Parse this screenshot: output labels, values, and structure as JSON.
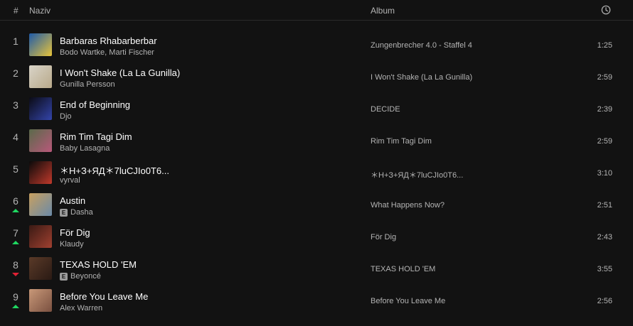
{
  "header": {
    "num_label": "#",
    "title_label": "Naziv",
    "album_label": "Album",
    "duration_icon": "clock-icon"
  },
  "tracks": [
    {
      "num": "1",
      "title": "Barbaras Rhabarberbar",
      "artist": "Bodo Wartke, Marti Fischer",
      "explicit": false,
      "album": "Zungenbrecher 4.0 - Staffel 4",
      "duration": "1:25",
      "trend": "none",
      "cover_colors": [
        "#1e5aa8",
        "#e8c43a"
      ]
    },
    {
      "num": "2",
      "title": "I Won't Shake (La La Gunilla)",
      "artist": "Gunilla Persson",
      "explicit": false,
      "album": "I Won't Shake (La La Gunilla)",
      "duration": "2:59",
      "trend": "none",
      "cover_colors": [
        "#d9d4c8",
        "#b8a98a"
      ]
    },
    {
      "num": "3",
      "title": "End of Beginning",
      "artist": "Djo",
      "explicit": false,
      "album": "DECIDE",
      "duration": "2:39",
      "trend": "none",
      "cover_colors": [
        "#0b0b14",
        "#3344aa"
      ]
    },
    {
      "num": "4",
      "title": "Rim Tim Tagi Dim",
      "artist": "Baby Lasagna",
      "explicit": false,
      "album": "Rim Tim Tagi Dim",
      "duration": "2:59",
      "trend": "none",
      "cover_colors": [
        "#5a6a4a",
        "#b8587a"
      ]
    },
    {
      "num": "5",
      "title": "＊Н+З+ЯД＊7luCJIo0T6...",
      "artist": "vyrval",
      "explicit": false,
      "album": "＊Н+З+ЯД＊7luCJIo0T6...",
      "duration": "3:10",
      "trend": "none",
      "cover_colors": [
        "#0a0a0a",
        "#c0392b"
      ]
    },
    {
      "num": "6",
      "title": "Austin",
      "artist": "Dasha",
      "explicit": true,
      "album": "What Happens Now?",
      "duration": "2:51",
      "trend": "up",
      "cover_colors": [
        "#c8a060",
        "#6a8aa8"
      ]
    },
    {
      "num": "7",
      "title": "För Dig",
      "artist": "Klaudy",
      "explicit": false,
      "album": "För Dig",
      "duration": "2:43",
      "trend": "up",
      "cover_colors": [
        "#3a1a14",
        "#a04030"
      ]
    },
    {
      "num": "8",
      "title": "TEXAS HOLD 'EM",
      "artist": "Beyoncé",
      "explicit": true,
      "album": "TEXAS HOLD 'EM",
      "duration": "3:55",
      "trend": "down",
      "cover_colors": [
        "#5a3a28",
        "#2a1a14"
      ]
    },
    {
      "num": "9",
      "title": "Before You Leave Me",
      "artist": "Alex Warren",
      "explicit": false,
      "album": "Before You Leave Me",
      "duration": "2:56",
      "trend": "up",
      "cover_colors": [
        "#c89878",
        "#7a5040"
      ]
    }
  ],
  "explicit_badge": "E"
}
